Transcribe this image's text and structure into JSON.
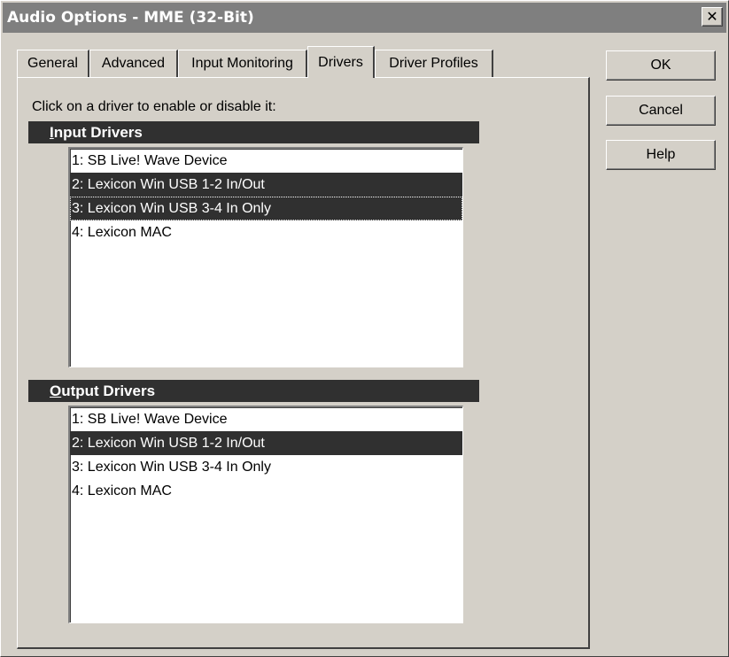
{
  "window": {
    "title": "Audio Options - MME (32-Bit)",
    "close_glyph": "✕"
  },
  "tabs": [
    {
      "label": "General",
      "active": false
    },
    {
      "label": "Advanced",
      "active": false
    },
    {
      "label": "Input Monitoring",
      "active": false
    },
    {
      "label": "Drivers",
      "active": true
    },
    {
      "label": "Driver Profiles",
      "active": false
    }
  ],
  "panel": {
    "instruction": "Click on a driver to enable or disable it:",
    "input_section": {
      "mnemonic": "I",
      "rest": "nput Drivers"
    },
    "output_section": {
      "mnemonic": "O",
      "rest": "utput Drivers"
    },
    "input_drivers": [
      {
        "label": "1: SB Live! Wave Device",
        "selected": false
      },
      {
        "label": "2: Lexicon Win USB 1-2 In/Out",
        "selected": true
      },
      {
        "label": "3: Lexicon Win USB 3-4 In Only",
        "selected": true
      },
      {
        "label": "4: Lexicon MAC",
        "selected": false
      }
    ],
    "output_drivers": [
      {
        "label": "1: SB Live! Wave Device",
        "selected": false
      },
      {
        "label": "2: Lexicon Win USB 1-2 In/Out",
        "selected": true
      },
      {
        "label": "3: Lexicon Win USB 3-4 In Only",
        "selected": false
      },
      {
        "label": "4: Lexicon MAC",
        "selected": false
      }
    ]
  },
  "buttons": {
    "ok": "OK",
    "cancel": "Cancel",
    "help": "Help"
  }
}
